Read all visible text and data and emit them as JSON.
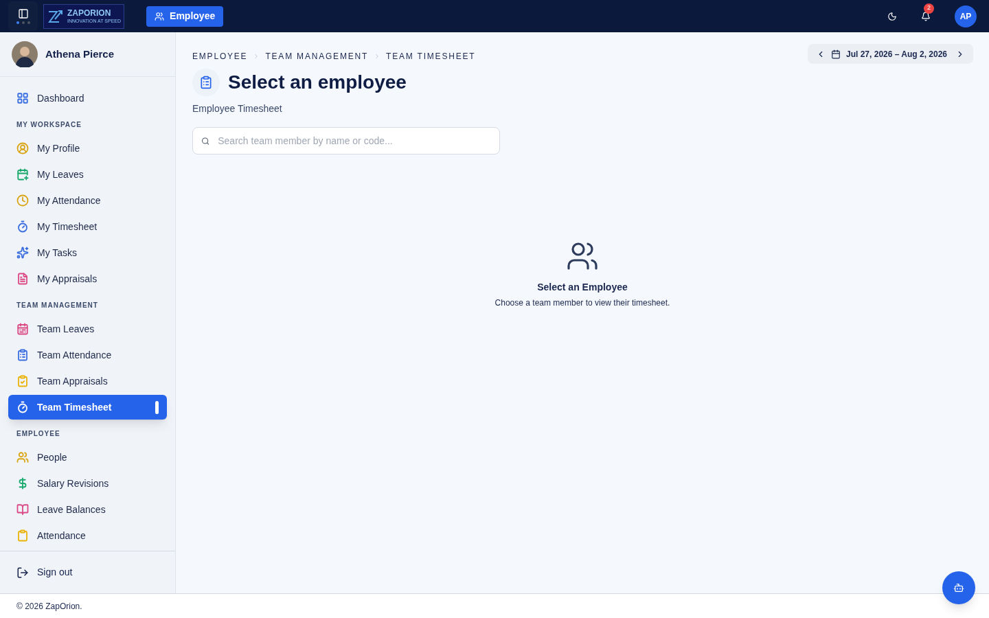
{
  "topbar": {
    "logo": {
      "name": "ZAPORION",
      "tagline": "INNOVATION AT SPEED"
    },
    "module_button": "Employee",
    "notifications": "2",
    "user_initials": "AP",
    "layout_dots": [
      {
        "selected": true
      },
      {
        "selected": false
      },
      {
        "selected": false
      }
    ]
  },
  "sidebar": {
    "user": "Athena Pierce",
    "top_items": [
      {
        "label": "Dashboard",
        "color": "#3b6fe0",
        "selected": false
      }
    ],
    "sections": [
      {
        "title": "MY WORKSPACE",
        "items": [
          {
            "label": "My Profile",
            "color": "#d9a514",
            "selected": false
          },
          {
            "label": "My Leaves",
            "color": "#18a86b",
            "selected": false
          },
          {
            "label": "My Attendance",
            "color": "#d9a514",
            "selected": false
          },
          {
            "label": "My Timesheet",
            "color": "#3b6fe0",
            "selected": false
          },
          {
            "label": "My Tasks",
            "color": "#3b6fe0",
            "selected": false
          },
          {
            "label": "My Appraisals",
            "color": "#db4a86",
            "selected": false
          }
        ]
      },
      {
        "title": "TEAM MANAGEMENT",
        "items": [
          {
            "label": "Team Leaves",
            "color": "#db4a86",
            "selected": false
          },
          {
            "label": "Team Attendance",
            "color": "#3b6fe0",
            "selected": false
          },
          {
            "label": "Team Appraisals",
            "color": "#eab308",
            "selected": false
          },
          {
            "label": "Team Timesheet",
            "color": "#ffffff",
            "selected": true
          }
        ]
      },
      {
        "title": "EMPLOYEE",
        "items": [
          {
            "label": "People",
            "color": "#d9a514",
            "selected": false
          },
          {
            "label": "Salary Revisions",
            "color": "#18a86b",
            "selected": false
          },
          {
            "label": "Leave Balances",
            "color": "#db4a86",
            "selected": false
          },
          {
            "label": "Attendance",
            "color": "#eab308",
            "selected": false
          }
        ]
      }
    ],
    "sign_out": "Sign out"
  },
  "breadcrumb": [
    "EMPLOYEE",
    "TEAM MANAGEMENT",
    "TEAM TIMESHEET"
  ],
  "date_range": "Jul 27, 2026 – Aug 2, 2026",
  "title": "Select an employee",
  "subtitle": "Employee Timesheet",
  "search": {
    "placeholder": "Search team member by name or code..."
  },
  "empty_state": {
    "title": "Select an Employee",
    "message": "Choose a team member to view their timesheet."
  },
  "footer": "© 2026 ZapOrion."
}
